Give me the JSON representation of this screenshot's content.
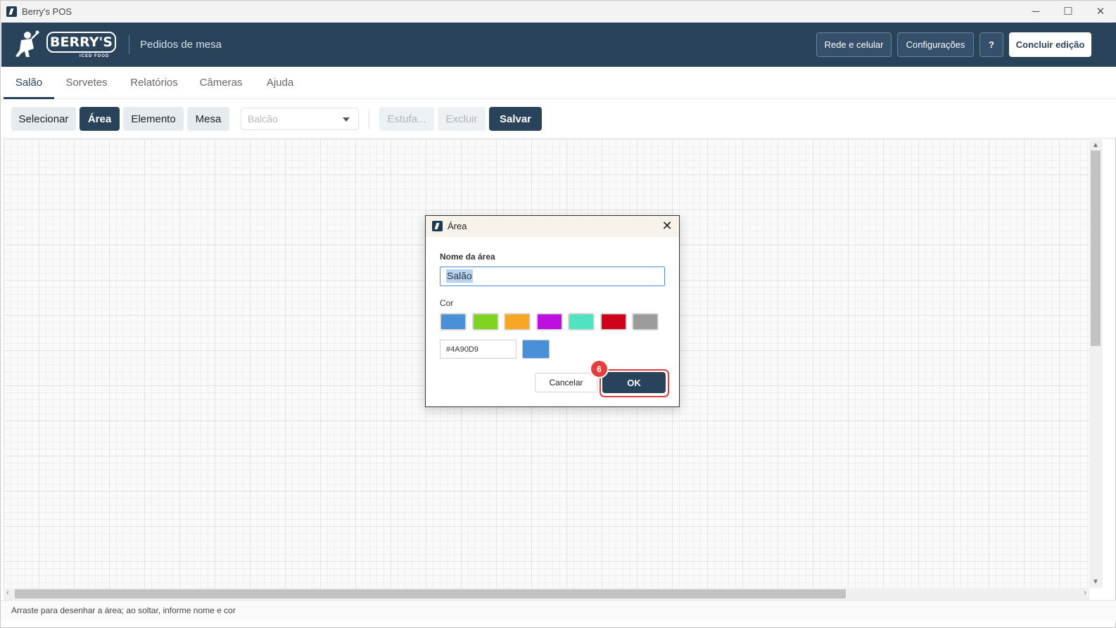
{
  "window": {
    "title": "Berry's POS",
    "controls": {
      "minimize": "─",
      "maximize": "☐",
      "close": "✕"
    }
  },
  "header": {
    "logo_text": "BERRY'S",
    "logo_subtext": "ICED FOOD",
    "section_title": "Pedidos de mesa",
    "buttons": {
      "network": "Rede e celular",
      "settings": "Configurações",
      "help": "?",
      "finish": "Concluir edição"
    },
    "colors": {
      "background": "#29445a",
      "button": "#35506a"
    }
  },
  "tabs": [
    {
      "label": "Salão",
      "active": true
    },
    {
      "label": "Sorvetes",
      "active": false
    },
    {
      "label": "Relatórios",
      "active": false
    },
    {
      "label": "Câmeras",
      "active": false
    },
    {
      "label": "Ajuda",
      "active": false
    }
  ],
  "toolbar": {
    "select": "Selecionar",
    "area": "Área",
    "element": "Elemento",
    "table": "Mesa",
    "area_select_value": "Balcão",
    "stove": "Estufa...",
    "delete": "Excluir",
    "save": "Salvar"
  },
  "status_bar": {
    "hint": "Arraste para desenhar a área; ao soltar, informe nome e cor"
  },
  "dialog": {
    "title": "Área",
    "close_icon": "close-icon",
    "name_label": "Nome da área",
    "name_value": "Salão",
    "color_label": "Cor",
    "swatches": [
      "#4A90D9",
      "#7ED321",
      "#F5A623",
      "#BD10E0",
      "#50E3C2",
      "#D0021B",
      "#9B9B9B"
    ],
    "hex_value": "#4A90D9",
    "preview_color": "#4A90D9",
    "cancel": "Cancelar",
    "ok": "OK",
    "step_badge": "6",
    "highlight_color": "#e03a3a"
  }
}
